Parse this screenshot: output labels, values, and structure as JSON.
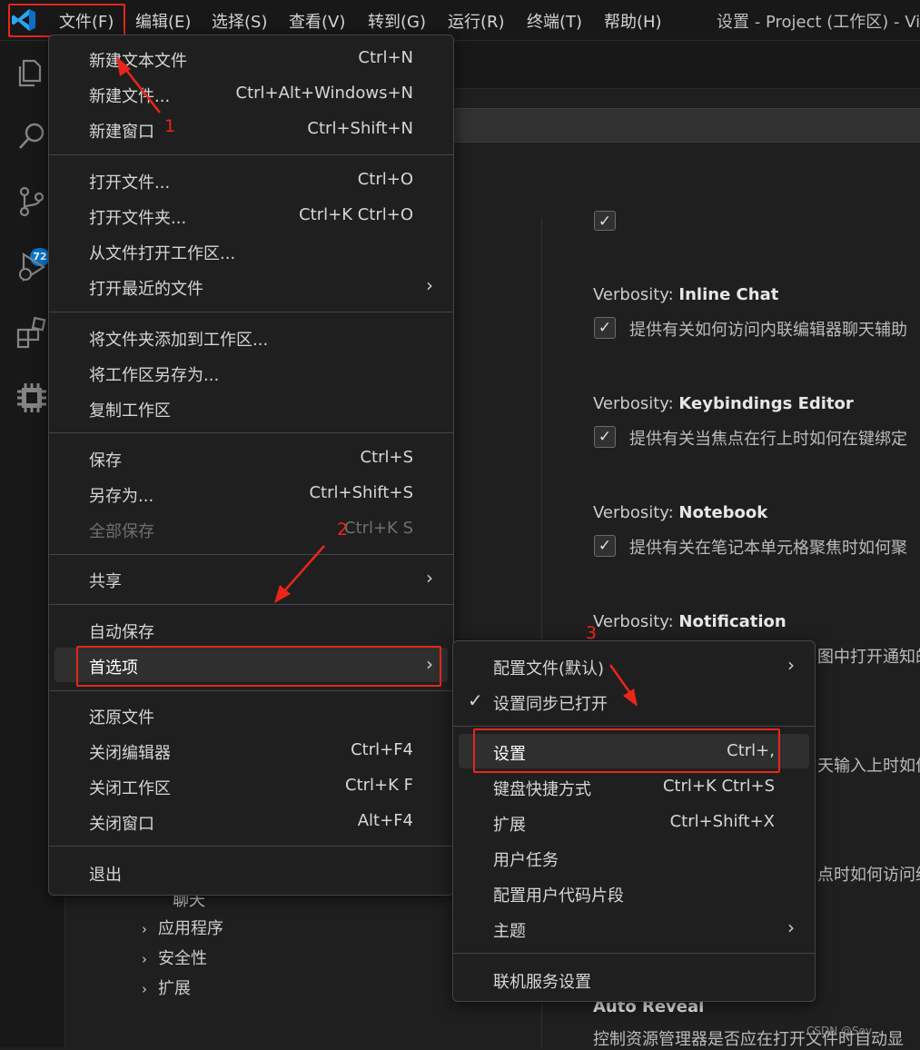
{
  "titlebar": {
    "menus": [
      "文件(F)",
      "编辑(E)",
      "选择(S)",
      "查看(V)",
      "转到(G)",
      "运行(R)",
      "终端(T)",
      "帮助(H)"
    ],
    "window_title": "设置 - Project (工作区) - Visu"
  },
  "activity": {
    "scm_badge": "72"
  },
  "settings": [
    {
      "prefix": "Verbosity: ",
      "name": "Inline Chat",
      "desc": "提供有关如何访问内联编辑器聊天辅助"
    },
    {
      "prefix": "Verbosity: ",
      "name": "Keybindings Editor",
      "desc": "提供有关当焦点在行上时如何在键绑定"
    },
    {
      "prefix": "Verbosity: ",
      "name": "Notebook",
      "desc": "提供有关在笔记本单元格聚焦时如何聚"
    },
    {
      "prefix": "Verbosity: ",
      "name": "Notification",
      "desc": "图中打开通知的"
    }
  ],
  "settings_misc": {
    "desc_partial_1": "天输入上时如何",
    "desc_partial_2": "点时如何访问终",
    "auto_reveal_title": "Auto Reveal",
    "auto_reveal_desc": "控制资源管理器是否应在打开文件时自动显"
  },
  "tree": {
    "partial": "聊天",
    "items": [
      "应用程序",
      "安全性",
      "扩展"
    ]
  },
  "file_menu": {
    "new_text_file": {
      "label": "新建文本文件",
      "key": "Ctrl+N"
    },
    "new_file": {
      "label": "新建文件...",
      "key": "Ctrl+Alt+Windows+N"
    },
    "new_window": {
      "label": "新建窗口",
      "key": "Ctrl+Shift+N"
    },
    "open_file": {
      "label": "打开文件...",
      "key": "Ctrl+O"
    },
    "open_folder": {
      "label": "打开文件夹...",
      "key": "Ctrl+K Ctrl+O"
    },
    "open_workspace": {
      "label": "从文件打开工作区..."
    },
    "open_recent": {
      "label": "打开最近的文件"
    },
    "add_folder": {
      "label": "将文件夹添加到工作区..."
    },
    "save_workspace_as": {
      "label": "将工作区另存为..."
    },
    "duplicate_workspace": {
      "label": "复制工作区"
    },
    "save": {
      "label": "保存",
      "key": "Ctrl+S"
    },
    "save_as": {
      "label": "另存为...",
      "key": "Ctrl+Shift+S"
    },
    "save_all": {
      "label": "全部保存",
      "key": "Ctrl+K S"
    },
    "share": {
      "label": "共享"
    },
    "auto_save": {
      "label": "自动保存"
    },
    "preferences": {
      "label": "首选项"
    },
    "revert": {
      "label": "还原文件"
    },
    "close_editor": {
      "label": "关闭编辑器",
      "key": "Ctrl+F4"
    },
    "close_workspace": {
      "label": "关闭工作区",
      "key": "Ctrl+K F"
    },
    "close_window": {
      "label": "关闭窗口",
      "key": "Alt+F4"
    },
    "exit": {
      "label": "退出"
    }
  },
  "prefs_menu": {
    "profile": {
      "label": "配置文件(默认)"
    },
    "sync": {
      "label": "设置同步已打开"
    },
    "settings": {
      "label": "设置",
      "key": "Ctrl+,"
    },
    "keyboard": {
      "label": "键盘快捷方式",
      "key": "Ctrl+K Ctrl+S"
    },
    "extensions": {
      "label": "扩展",
      "key": "Ctrl+Shift+X"
    },
    "user_tasks": {
      "label": "用户任务"
    },
    "snippets": {
      "label": "配置用户代码片段"
    },
    "theme": {
      "label": "主题"
    },
    "online_services": {
      "label": "联机服务设置"
    }
  },
  "annotations": [
    "1",
    "2",
    "3"
  ],
  "watermark": "CSDN @Sov...",
  "colors": {
    "accent": "#0078d4",
    "annotation_red": "#e8261b",
    "menu_bg": "#1f1f1f"
  }
}
